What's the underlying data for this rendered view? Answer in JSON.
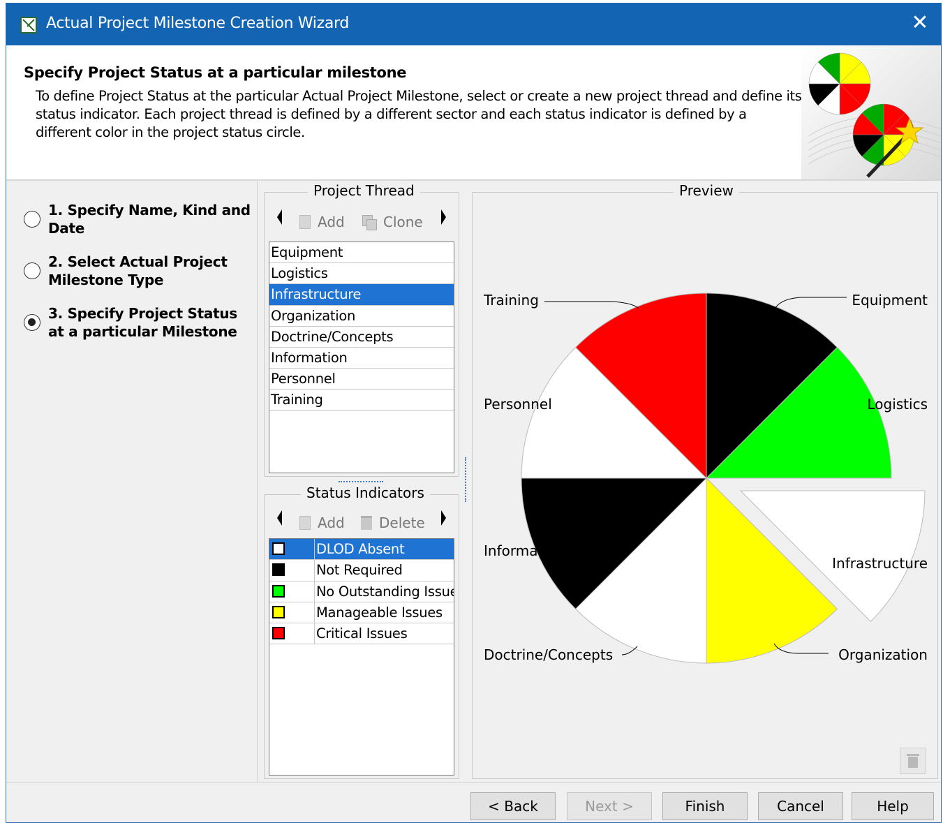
{
  "window": {
    "title": "Actual Project Milestone Creation Wizard",
    "close_glyph": "✕"
  },
  "header": {
    "heading": "Specify Project Status at a particular milestone",
    "description": "To define Project Status at the particular Actual Project Milestone, select or create a new project thread and define its status indicator. Each project thread is defined by a different sector and each status indicator is defined by a different color in the project status circle."
  },
  "steps": [
    {
      "label": "1. Specify Name, Kind and Date",
      "selected": false
    },
    {
      "label": "2. Select Actual Project Milestone Type",
      "selected": false
    },
    {
      "label": "3. Specify Project Status at a particular Milestone",
      "selected": true
    }
  ],
  "project_thread": {
    "legend": "Project Thread",
    "add_label": "Add",
    "clone_label": "Clone",
    "items": [
      "Equipment",
      "Logistics",
      "Infrastructure",
      "Organization",
      "Doctrine/Concepts",
      "Information",
      "Personnel",
      "Training"
    ],
    "selected_index": 2
  },
  "status_indicators": {
    "legend": "Status Indicators",
    "add_label": "Add",
    "delete_label": "Delete",
    "items": [
      {
        "name": "DLOD Absent",
        "color": "#ffffff"
      },
      {
        "name": "Not Required",
        "color": "#000000"
      },
      {
        "name": "No Outstanding Issue",
        "color": "#00ff00"
      },
      {
        "name": "Manageable Issues",
        "color": "#ffff00"
      },
      {
        "name": "Critical Issues",
        "color": "#ff0000"
      }
    ],
    "selected_index": 0
  },
  "preview": {
    "legend": "Preview",
    "labels": {
      "training": "Training",
      "equipment": "Equipment",
      "personnel": "Personnel",
      "logistics": "Logistics",
      "information": "Information",
      "infrastructure": "Infrastructure",
      "doctrine": "Doctrine/Concepts",
      "organization": "Organization"
    }
  },
  "buttons": {
    "back": "< Back",
    "next": "Next >",
    "finish": "Finish",
    "cancel": "Cancel",
    "help": "Help"
  },
  "colors": {
    "titlebar": "#1464b4",
    "selection": "#1f73d3",
    "red": "#ff0000",
    "green": "#00ff00",
    "yellow": "#ffff00",
    "black": "#000000",
    "white": "#ffffff"
  }
}
